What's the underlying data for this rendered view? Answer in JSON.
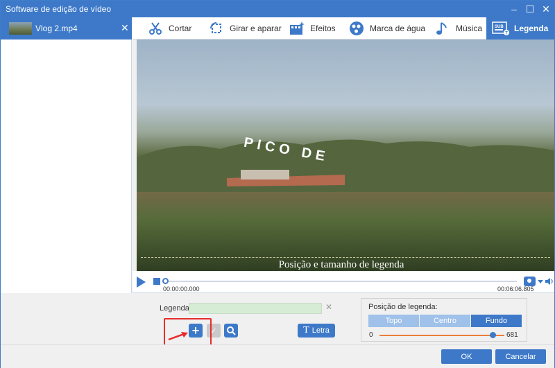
{
  "window": {
    "title": "Software de edição de vídeo",
    "controls": [
      "minimize-icon",
      "maximize-icon",
      "close-icon"
    ]
  },
  "sidebar": {
    "file": {
      "name": "Vlog 2.mp4",
      "close": "✕"
    }
  },
  "tabs": [
    {
      "label": "Cortar",
      "icon": "scissors-icon"
    },
    {
      "label": "Girar e aparar",
      "icon": "rotate-crop-icon"
    },
    {
      "label": "Efeitos",
      "icon": "effects-icon"
    },
    {
      "label": "Marca de água",
      "icon": "watermark-icon"
    },
    {
      "label": "Música",
      "icon": "music-icon"
    },
    {
      "label": "Legenda",
      "icon": "subtitle-icon",
      "active": true
    }
  ],
  "preview": {
    "subtitle_text": "Posição e tamanho de legenda",
    "overlay_text": "PICO DE"
  },
  "player": {
    "time_start": "00:00:00.000",
    "time_end": "00:06:06.805"
  },
  "subtitle_panel": {
    "label": "Legenda:",
    "input_value": "",
    "clear": "✕",
    "letra_label": "Letra",
    "position_title": "Posição de legenda:",
    "position_options": [
      "Topo",
      "Centro",
      "Fundo"
    ],
    "position_selected": "Fundo",
    "slider_min": "0",
    "slider_max": "681",
    "slider_value_fraction": 1.0
  },
  "footer": {
    "ok_label": "OK",
    "cancel_label": "Cancelar"
  },
  "colors": {
    "accent": "#3d79c8",
    "highlight_box": "#e82b2b",
    "slider_track": "#e97f3a"
  }
}
